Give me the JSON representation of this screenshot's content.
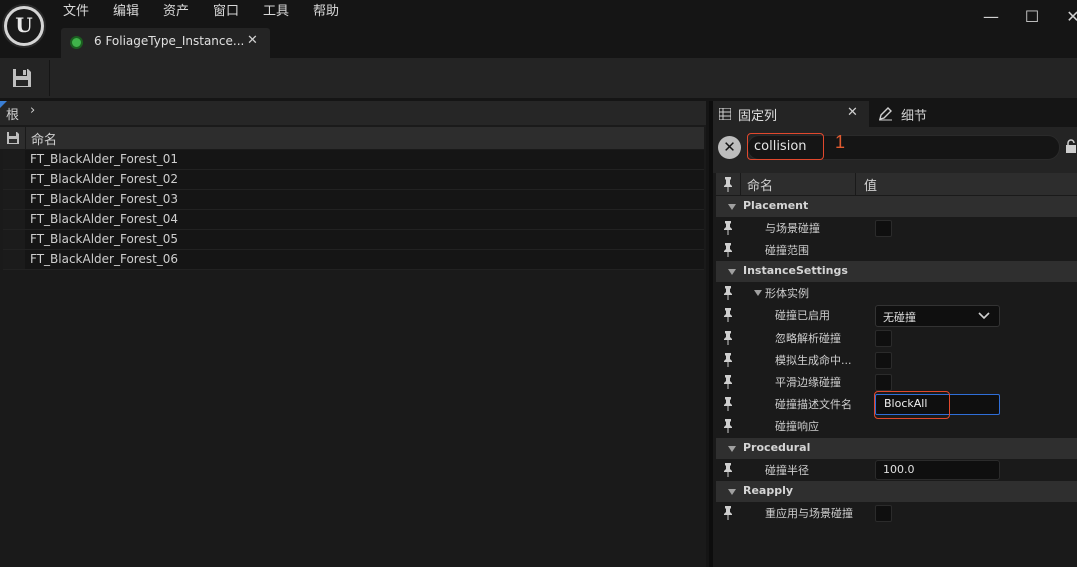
{
  "menu": [
    "文件",
    "编辑",
    "资产",
    "窗口",
    "工具",
    "帮助"
  ],
  "logo_text": "U",
  "window": {
    "minimize": "—",
    "maximize": "☐",
    "close": "✕"
  },
  "tab": {
    "title": "6 FoliageType_Instance...",
    "close": "✕"
  },
  "left_panel": {
    "breadcrumb": {
      "root": "根",
      "arrow": "›"
    },
    "header": "命名",
    "rows": [
      "FT_BlackAlder_Forest_01",
      "FT_BlackAlder_Forest_02",
      "FT_BlackAlder_Forest_03",
      "FT_BlackAlder_Forest_04",
      "FT_BlackAlder_Forest_05",
      "FT_BlackAlder_Forest_06"
    ]
  },
  "right_panel": {
    "tab_pinned": "固定列",
    "tab_pinned_close": "✕",
    "tab_details": "细节",
    "search": {
      "value": "collision",
      "clear": "✕"
    },
    "annotation_1": "1",
    "header": {
      "name": "命名",
      "value": "值"
    },
    "categories": {
      "placement": "Placement",
      "instance_settings": "InstanceSettings",
      "procedural": "Procedural",
      "reapply": "Reapply"
    },
    "props": {
      "collide_with_world": "与场景碰撞",
      "collision_scale": "碰撞范围",
      "body_instance": "形体实例",
      "collision_enabled": "碰撞已启用",
      "collision_enabled_value": "无碰撞",
      "ignore_analytic": "忽略解析碰撞",
      "sim_gen_hit": "模拟生成命中...",
      "smooth_edge": "平滑边缘碰撞",
      "profile_name": "碰撞描述文件名",
      "profile_name_value": "BlockAll",
      "collision_response": "碰撞响应",
      "collision_radius": "碰撞半径",
      "collision_radius_value": "100.0",
      "reapply_collide": "重应用与场景碰撞"
    }
  },
  "colors": {
    "annotation": "#e1482d",
    "focus": "#2f6ed8",
    "tab_icon": "#3fb24a"
  }
}
